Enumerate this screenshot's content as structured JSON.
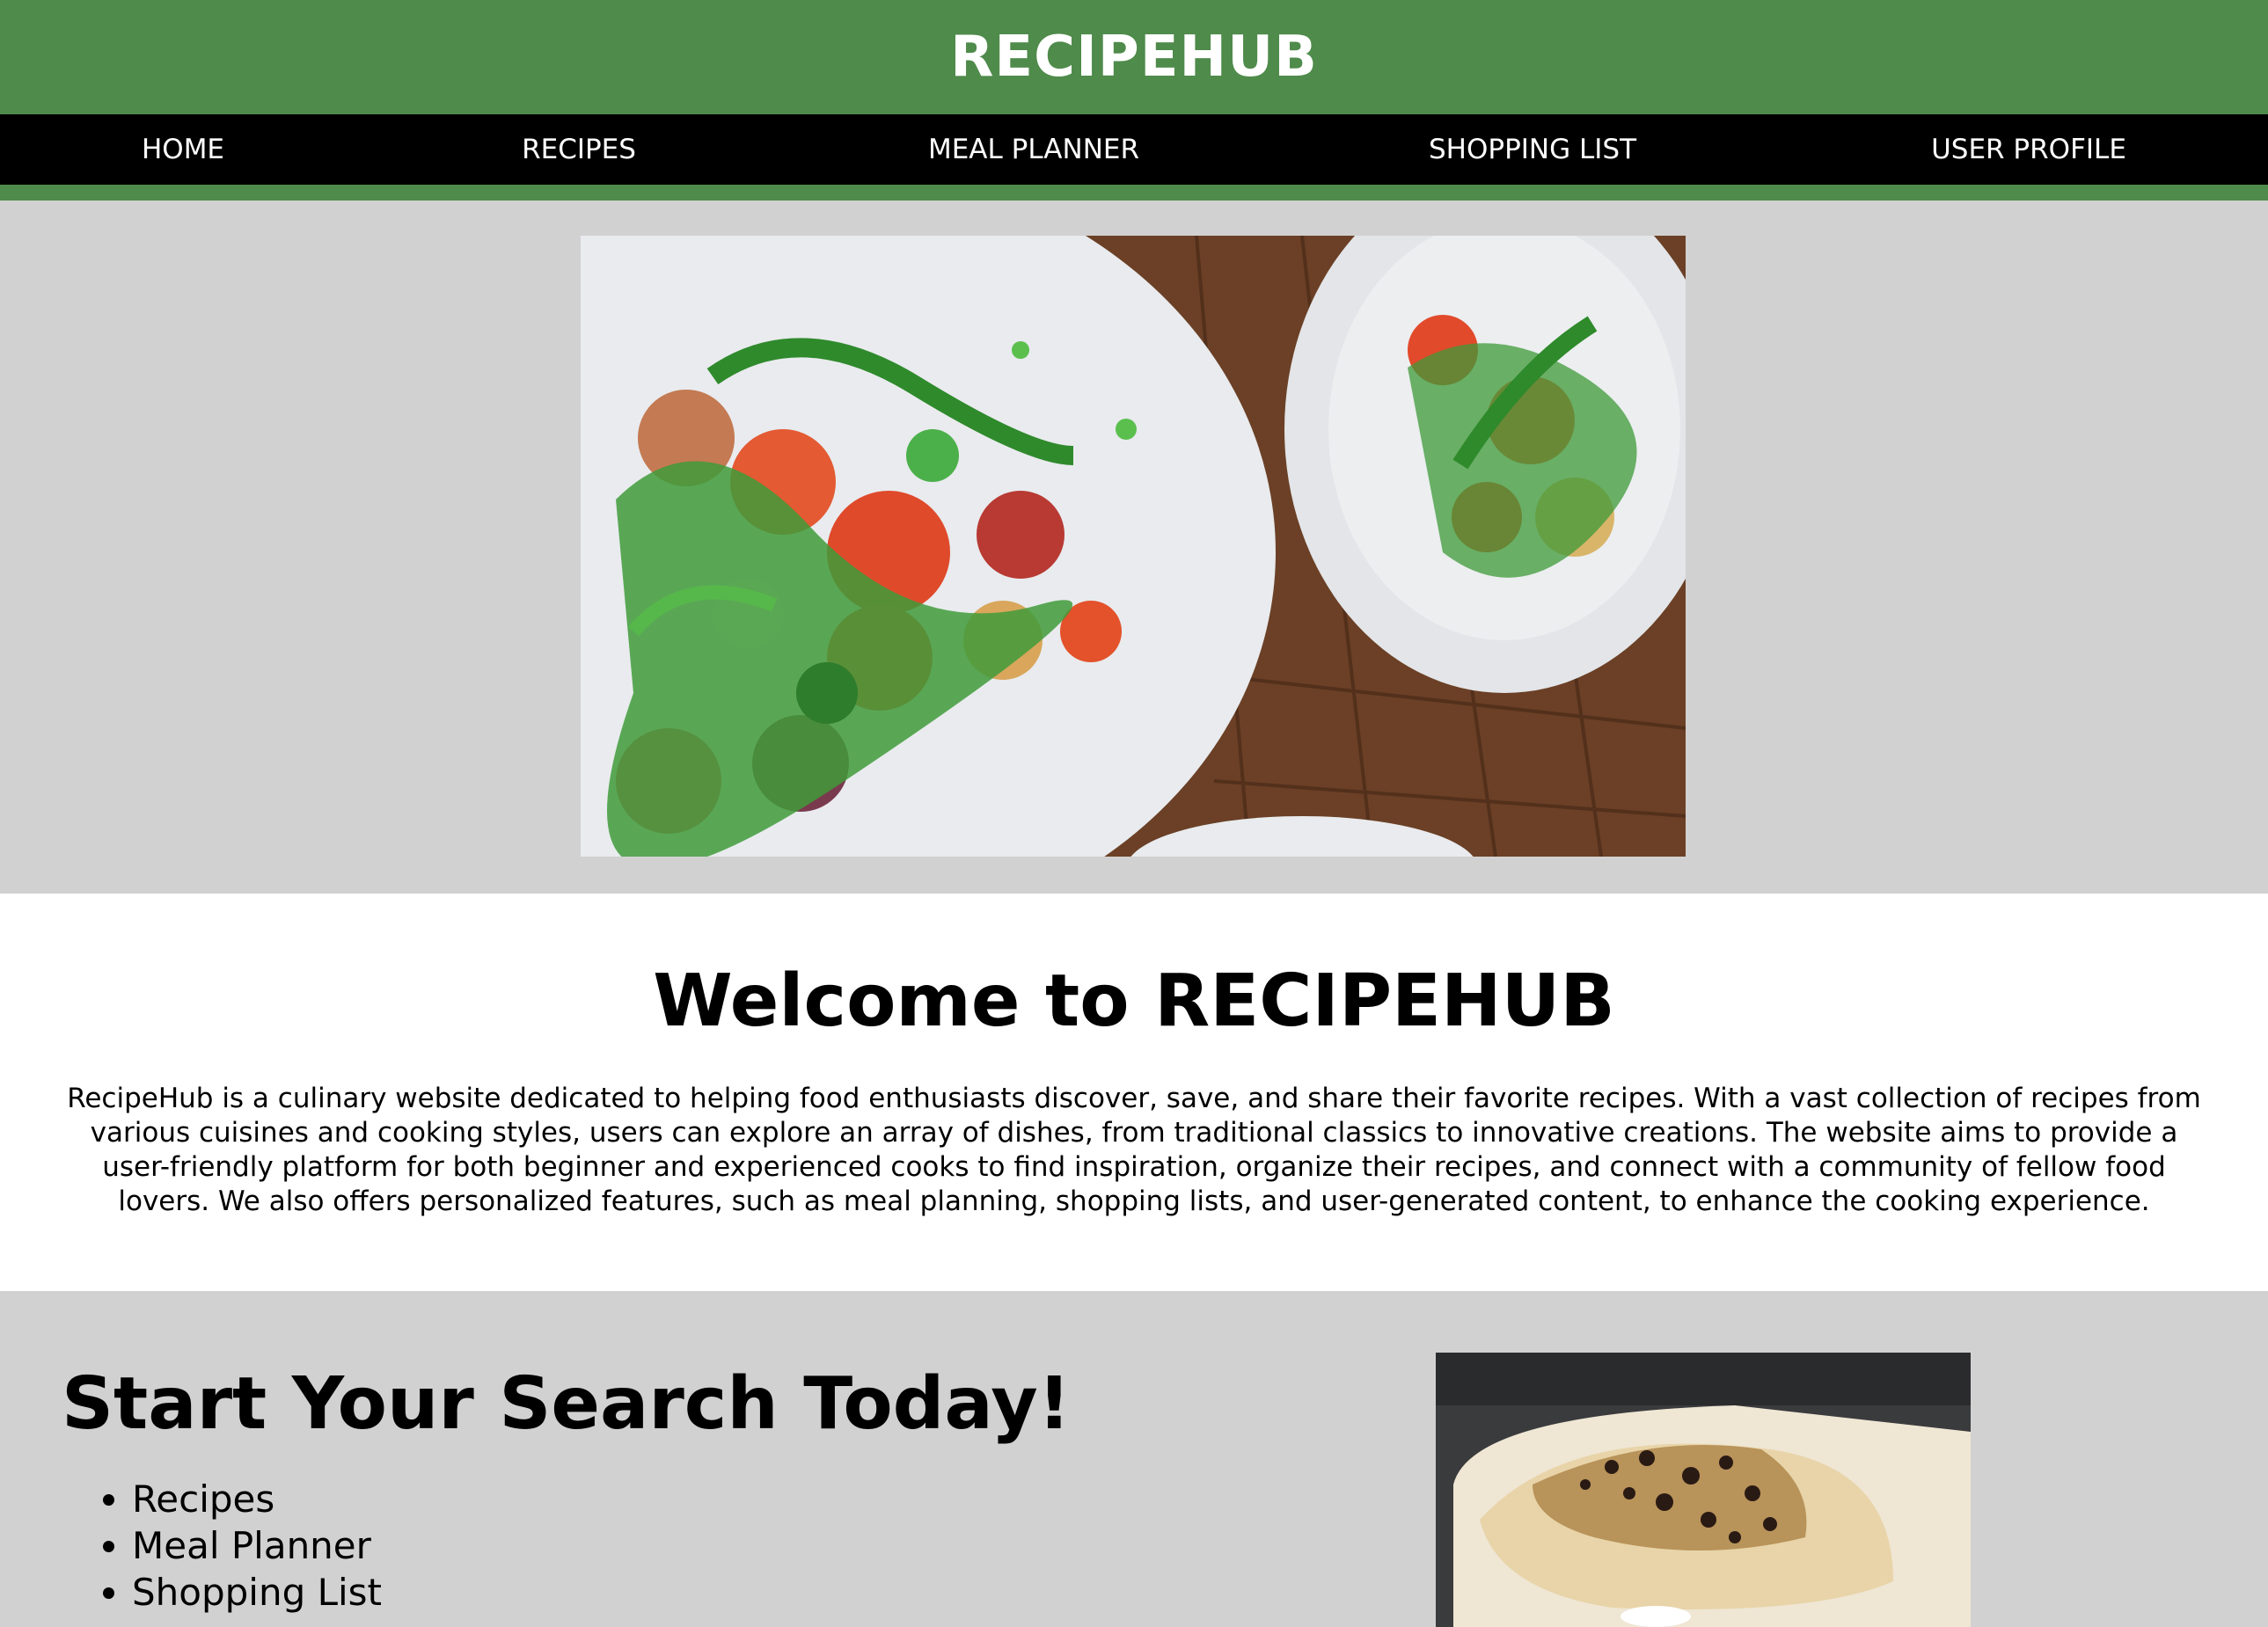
{
  "header": {
    "title": "RECIPEHUB"
  },
  "nav": {
    "items": [
      {
        "label": "HOME"
      },
      {
        "label": "RECIPES"
      },
      {
        "label": "MEAL PLANNER"
      },
      {
        "label": "SHOPPING LIST"
      },
      {
        "label": "USER PROFILE"
      }
    ]
  },
  "welcome": {
    "heading": "Welcome to RECIPEHUB",
    "body": "RecipeHub is a culinary website dedicated to helping food enthusiasts discover, save, and share their favorite recipes. With a vast collection of recipes from various cuisines and cooking styles, users can explore an array of dishes, from traditional classics to innovative creations. The website aims to provide a user-friendly platform for both beginner and experienced cooks to find inspiration, organize their recipes, and connect with a community of fellow food lovers. We also offers personalized features, such as meal planning, shopping lists, and user-generated content, to enhance the cooking experience."
  },
  "search": {
    "heading": "Start Your Search Today!",
    "items": [
      "Recipes",
      "Meal Planner",
      "Shopping List"
    ]
  },
  "colors": {
    "header_green": "#4f8b4b",
    "nav_black": "#000000",
    "section_gray": "#d1d1d1",
    "welcome_white": "#ffffff"
  }
}
